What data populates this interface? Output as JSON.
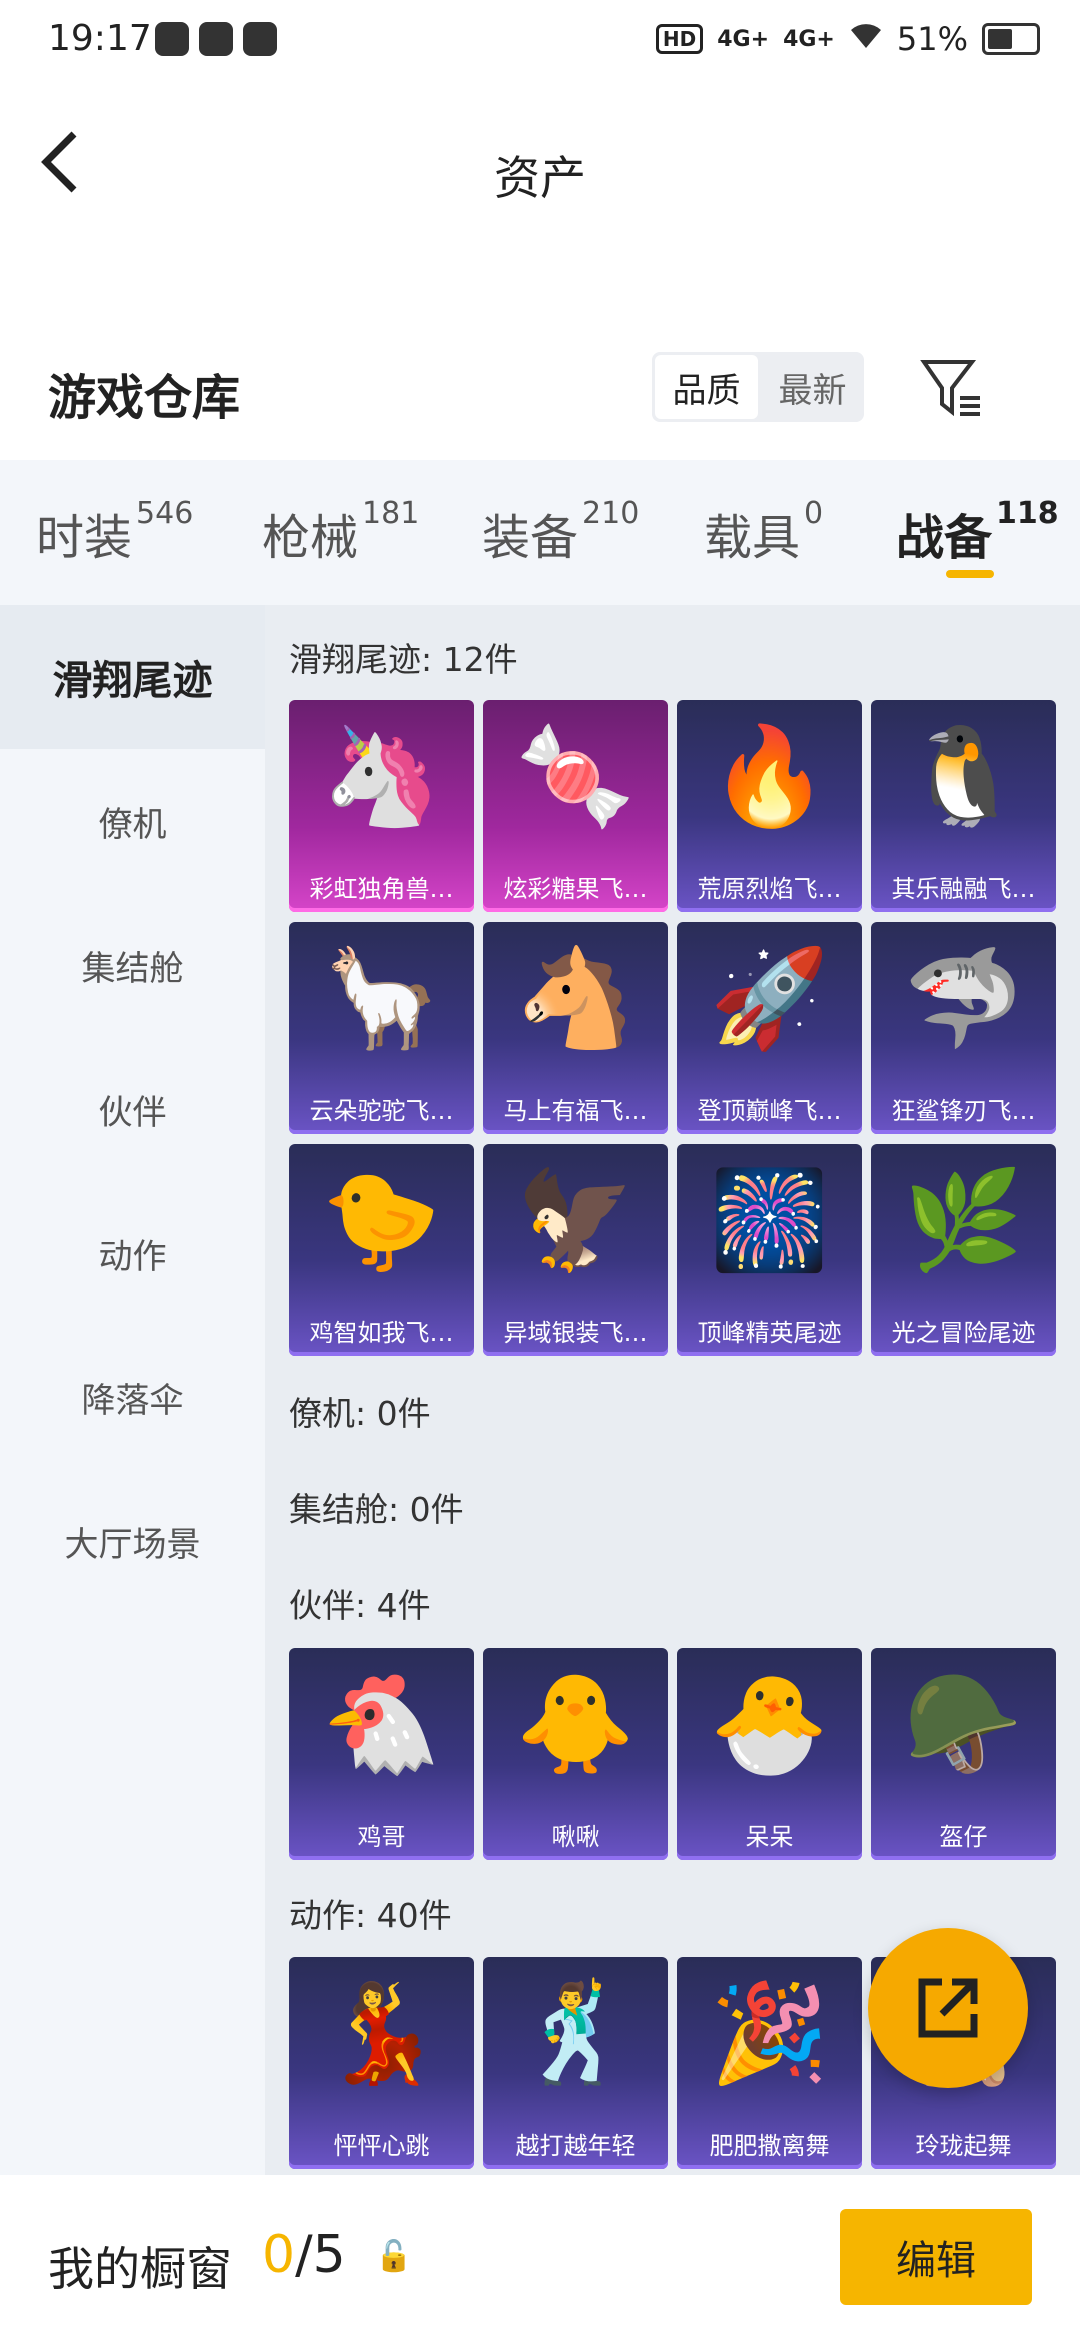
{
  "status": {
    "time": "19:17",
    "battery": "51%",
    "hd": "HD",
    "sig1": "4G+",
    "sig2": "4G+"
  },
  "header": {
    "title": "资产"
  },
  "warehouse": {
    "title": "游戏仓库",
    "sort": [
      "品质",
      "最新"
    ]
  },
  "tabs": [
    {
      "label": "时装",
      "count": "546"
    },
    {
      "label": "枪械",
      "count": "181"
    },
    {
      "label": "装备",
      "count": "210"
    },
    {
      "label": "载具",
      "count": "0"
    },
    {
      "label": "战备",
      "count": "118"
    }
  ],
  "sidebar": [
    "滑翔尾迹",
    "僚机",
    "集结舱",
    "伙伴",
    "动作",
    "降落伞",
    "大厅场景"
  ],
  "sections": {
    "glide": {
      "title": "滑翔尾迹: 12件",
      "items": [
        {
          "label": "彩虹独角兽…",
          "icon": "🦄",
          "rarity": "pink"
        },
        {
          "label": "炫彩糖果飞…",
          "icon": "🍬",
          "rarity": "pink"
        },
        {
          "label": "荒原烈焰飞…",
          "icon": "🔥",
          "rarity": "purple"
        },
        {
          "label": "其乐融融飞…",
          "icon": "🐧",
          "rarity": "purple"
        },
        {
          "label": "云朵驼驼飞…",
          "icon": "🦙",
          "rarity": "purple"
        },
        {
          "label": "马上有福飞…",
          "icon": "🐴",
          "rarity": "purple"
        },
        {
          "label": "登顶巅峰飞…",
          "icon": "🚀",
          "rarity": "purple"
        },
        {
          "label": "狂鲨锋刃飞…",
          "icon": "🦈",
          "rarity": "purple"
        },
        {
          "label": "鸡智如我飞…",
          "icon": "🐤",
          "rarity": "purple"
        },
        {
          "label": "异域银装飞…",
          "icon": "🦅",
          "rarity": "purple"
        },
        {
          "label": "顶峰精英尾迹",
          "icon": "🎆",
          "rarity": "purple"
        },
        {
          "label": "光之冒险尾迹",
          "icon": "🌿",
          "rarity": "purple"
        }
      ]
    },
    "wingman": {
      "title": "僚机: 0件"
    },
    "pod": {
      "title": "集结舱: 0件"
    },
    "partner": {
      "title": "伙伴: 4件",
      "items": [
        {
          "label": "鸡哥",
          "icon": "🐔",
          "rarity": "purple"
        },
        {
          "label": "啾啾",
          "icon": "🐥",
          "rarity": "purple"
        },
        {
          "label": "呆呆",
          "icon": "🐣",
          "rarity": "purple"
        },
        {
          "label": "盔仔",
          "icon": "🪖",
          "rarity": "purple"
        }
      ]
    },
    "emote": {
      "title": "动作: 40件",
      "items": [
        {
          "label": "怦怦心跳",
          "icon": "💃",
          "rarity": "purple"
        },
        {
          "label": "越打越年轻",
          "icon": "🕺",
          "rarity": "purple"
        },
        {
          "label": "肥肥撒离舞",
          "icon": "🎉",
          "rarity": "purple"
        },
        {
          "label": "玲珑起舞",
          "icon": "🩰",
          "rarity": "purple"
        }
      ]
    }
  },
  "bottom": {
    "label": "我的橱窗",
    "current": "0",
    "total": "/5",
    "edit": "编辑"
  },
  "colors": {
    "accent": "#f6b500",
    "card": "#3a3680",
    "rare": "#a0289e"
  }
}
